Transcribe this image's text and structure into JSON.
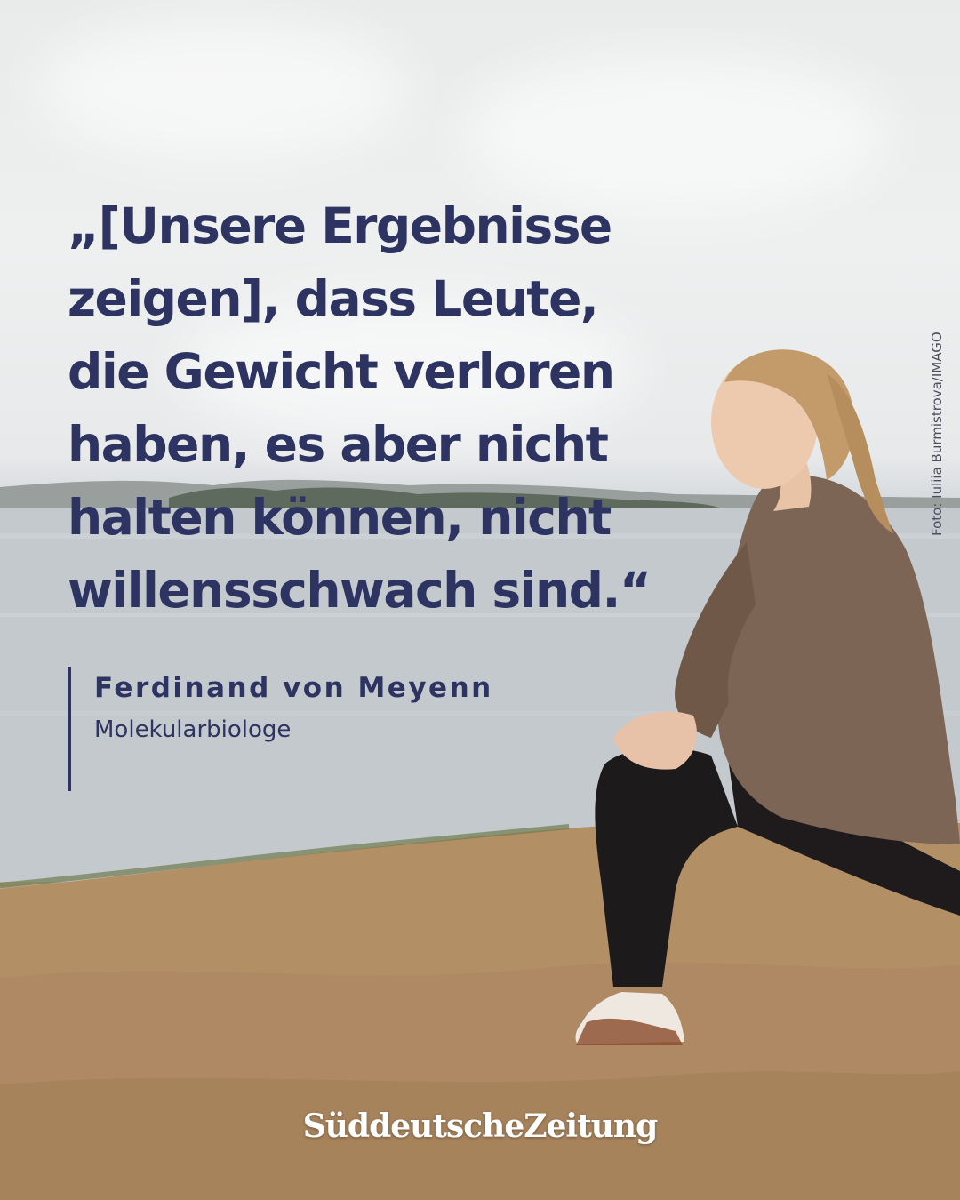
{
  "quote": {
    "lines": [
      "„[Unsere Ergebnisse",
      "zeigen], dass Leute,",
      "die Gewicht verloren",
      "haben, es aber nicht",
      "halten können, nicht",
      "willensschwach sind.“"
    ]
  },
  "attribution": {
    "name": "Ferdinand von Meyenn",
    "role": "Molekularbiologe"
  },
  "photo_credit": "Foto: Iuliia Burmistrova/IMAGO",
  "brand": {
    "logo_text": "SüddeutscheZeitung"
  },
  "colors": {
    "text_primary": "#2e3461",
    "logo": "#ffffff",
    "sand": "#b08c63",
    "water": "#c4cbd0"
  }
}
